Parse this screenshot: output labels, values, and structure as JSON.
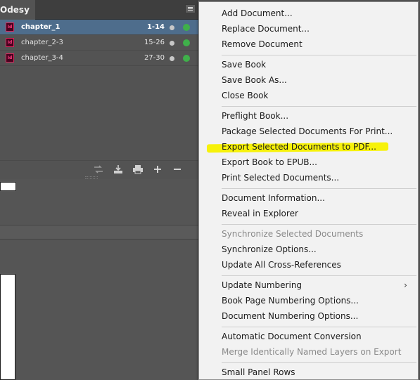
{
  "panel": {
    "tab_title": "Odesy",
    "documents": [
      {
        "icon": "Id",
        "name": "chapter_1",
        "pages": "1-14",
        "selected": true
      },
      {
        "icon": "Id",
        "name": "chapter_2-3",
        "pages": "15-26",
        "selected": false
      },
      {
        "icon": "Id",
        "name": "chapter_3-4",
        "pages": "27-30",
        "selected": false
      }
    ],
    "footer_icons": [
      "synchronize-icon",
      "save-book-icon",
      "print-book-icon",
      "add-document-icon",
      "remove-document-icon"
    ]
  },
  "menu": {
    "items": [
      {
        "label": "Add Document...",
        "enabled": true
      },
      {
        "label": "Replace Document...",
        "enabled": true
      },
      {
        "label": "Remove Document",
        "enabled": true
      },
      {
        "label": "Save Book",
        "enabled": true
      },
      {
        "label": "Save Book As...",
        "enabled": true
      },
      {
        "label": "Close Book",
        "enabled": true
      },
      {
        "label": "Preflight Book...",
        "enabled": true
      },
      {
        "label": "Package Selected Documents For Print...",
        "enabled": true
      },
      {
        "label": "Export Selected Documents to PDF...",
        "enabled": true,
        "highlighted": true
      },
      {
        "label": "Export Book to EPUB...",
        "enabled": true
      },
      {
        "label": "Print Selected Documents...",
        "enabled": true
      },
      {
        "label": "Document Information...",
        "enabled": true
      },
      {
        "label": "Reveal in Explorer",
        "enabled": true
      },
      {
        "label": "Synchronize Selected Documents",
        "enabled": false
      },
      {
        "label": "Synchronize Options...",
        "enabled": true
      },
      {
        "label": "Update All Cross-References",
        "enabled": true
      },
      {
        "label": "Update Numbering",
        "enabled": true,
        "submenu": true
      },
      {
        "label": "Book Page Numbering Options...",
        "enabled": true
      },
      {
        "label": "Document Numbering Options...",
        "enabled": true
      },
      {
        "label": "Automatic Document Conversion",
        "enabled": true
      },
      {
        "label": "Merge Identically Named Layers on Export",
        "enabled": false
      },
      {
        "label": "Small Panel Rows",
        "enabled": true
      }
    ]
  },
  "colors": {
    "panel_bg": "#535353",
    "selected_row": "#4e6d8c",
    "sync_green": "#3fb04a",
    "highlight_yellow": "#f7f20a",
    "menu_bg": "#f2f2f2",
    "indesign_icon": "#d6295c"
  }
}
